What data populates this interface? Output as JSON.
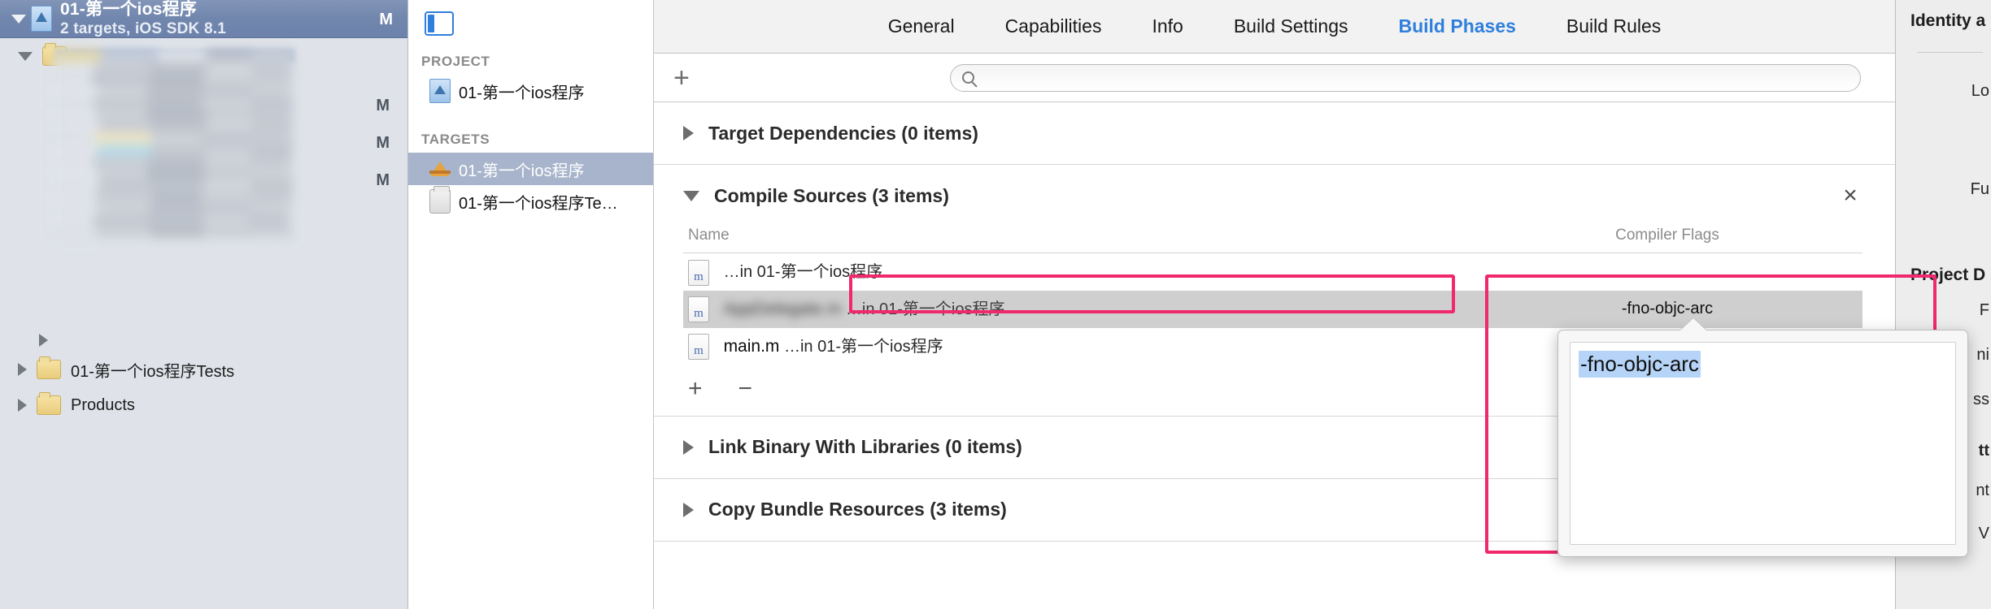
{
  "window": {
    "navigator_header": {
      "title": "01-第一个ios程序",
      "subtitle": "2 targets, iOS SDK 8.1",
      "status_badge": "M",
      "project_icon": "xcode-project-icon",
      "disclosure_icon": "disclosure-triangle-down-icon"
    },
    "navigator_tree": {
      "modified_badges": [
        "M",
        "M",
        "M"
      ],
      "items": [
        {
          "label": "",
          "redacted": true,
          "icon": "folder-icon",
          "state": "expanded"
        },
        {
          "label": "",
          "redacted": true,
          "icon": "folder-icon",
          "state": "collapsed"
        },
        {
          "label": "01-第一个ios程序Tests",
          "redacted": false,
          "icon": "folder-icon",
          "state": "collapsed"
        },
        {
          "label": "Products",
          "redacted": false,
          "icon": "folder-icon",
          "state": "collapsed"
        }
      ]
    }
  },
  "target_pane": {
    "project_section_label": "PROJECT",
    "project_items": [
      {
        "label": "01-第一个ios程序",
        "icon": "xcode-project-icon",
        "selected": false
      }
    ],
    "targets_section_label": "TARGETS",
    "target_items": [
      {
        "label": "01-第一个ios程序",
        "icon": "app-target-icon",
        "selected": true
      },
      {
        "label": "01-第一个ios程序Te…",
        "icon": "test-target-icon",
        "selected": false
      }
    ]
  },
  "editor": {
    "panel_toggle_icon": "left-panel-toggle-icon",
    "tabs": [
      {
        "label": "General",
        "active": false
      },
      {
        "label": "Capabilities",
        "active": false
      },
      {
        "label": "Info",
        "active": false
      },
      {
        "label": "Build Settings",
        "active": false
      },
      {
        "label": "Build Phases",
        "active": true
      },
      {
        "label": "Build Rules",
        "active": false
      }
    ],
    "toolbar": {
      "add_phase_label": "+",
      "add_phase_icon": "plus-icon",
      "search_placeholder": "",
      "search_value": "",
      "search_icon": "search-icon"
    },
    "phases": [
      {
        "title": "Target Dependencies (0 items)",
        "expanded": false,
        "name": "target-dependencies",
        "closable": false
      },
      {
        "title": "Compile Sources (3 items)",
        "expanded": true,
        "name": "compile-sources",
        "closable": true,
        "close_label": "×",
        "columns": {
          "name": "Name",
          "flags": "Compiler Flags"
        },
        "rows": [
          {
            "file": "",
            "file_redacted": true,
            "suffix": "…in 01-第一个ios程序",
            "flags": "",
            "selected": false,
            "icon": "objc-m-file-icon"
          },
          {
            "file": "AppDelegate.m",
            "file_redacted": true,
            "suffix": "…in 01-第一个ios程序",
            "flags": "-fno-objc-arc",
            "selected": true,
            "icon": "objc-m-file-icon"
          },
          {
            "file": "main.m",
            "file_redacted": false,
            "suffix": "…in 01-第一个ios程序",
            "flags": "",
            "selected": false,
            "icon": "objc-m-file-icon"
          }
        ],
        "add_label": "+",
        "remove_label": "−"
      },
      {
        "title": "Link Binary With Libraries (0 items)",
        "expanded": false,
        "name": "link-binary-with-libraries",
        "closable": false
      },
      {
        "title": "Copy Bundle Resources (3 items)",
        "expanded": false,
        "name": "copy-bundle-resources",
        "closable": false
      }
    ]
  },
  "compiler_flags_popover": {
    "value": "-fno-objc-arc",
    "selected": true
  },
  "inspector": {
    "identity_section": "Identity a",
    "location_label": "Lo",
    "full_path_label": "Fu",
    "project_document_section": "Project D",
    "rows": [
      "F",
      "ni",
      "ss",
      "tt",
      "nt",
      "V"
    ]
  },
  "annotations": {
    "highlight_color": "#f0286e",
    "boxes": [
      {
        "name": "selected-file-row-highlight"
      },
      {
        "name": "compiler-flags-popover-highlight"
      }
    ]
  },
  "colors": {
    "accent": "#2f7fdc",
    "highlight": "#f0286e",
    "nav_header": "#7186ad",
    "selection_blue": "#b6d4f7",
    "row_selected": "#cfcfcf"
  }
}
